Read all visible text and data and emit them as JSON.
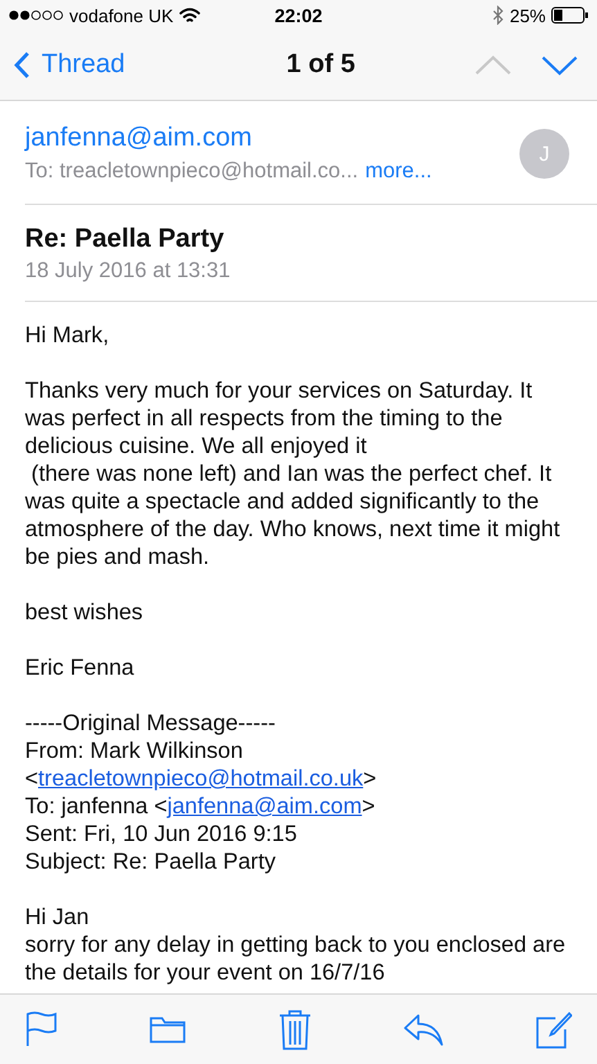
{
  "status_bar": {
    "carrier": "vodafone UK",
    "time": "22:02",
    "battery": "25%"
  },
  "nav": {
    "back": "Thread",
    "position": "1 of 5",
    "arrows": [
      {
        "kind": "up",
        "disabled": true
      },
      {
        "kind": "down",
        "disabled": false
      }
    ]
  },
  "header": {
    "from": "janfenna@aim.com",
    "to": "To: treacletownpieco@hotmail.co...",
    "more": "more...",
    "avatar": "J"
  },
  "subject": {
    "title": "Re: Paella Party",
    "date": "18 July 2016 at 13:31"
  },
  "body": [
    [
      "Hi Mark,"
    ],
    [
      "Thanks very much for your services on Saturday. It",
      "was perfect in all respects from the timing to the",
      "delicious cuisine. We all enjoyed it",
      " (there was none left) and Ian was the perfect chef. It",
      "was quite a spectacle and added significantly to the",
      "atmosphere of the day. Who knows, next time it might",
      "be pies and mash."
    ],
    [
      "best wishes"
    ],
    [
      "Eric Fenna"
    ],
    [
      "-----Original Message-----",
      "From: Mark Wilkinson",
      [
        {
          "text": "<"
        },
        {
          "text": "treacletownpieco@hotmail.co.uk",
          "link": true
        },
        {
          "text": ">"
        }
      ],
      [
        {
          "text": "To: janfenna <"
        },
        {
          "text": "janfenna@aim.com",
          "link": true
        },
        {
          "text": ">"
        }
      ],
      "Sent: Fri, 10 Jun 2016 9:15",
      "Subject: Re: Paella Party"
    ],
    [
      "Hi Jan",
      "sorry for any delay in getting back to you enclosed are",
      "the details for your event on 16/7/16"
    ]
  ],
  "toolbar": [
    {
      "kind": "flag"
    },
    {
      "kind": "folder"
    },
    {
      "kind": "trash"
    },
    {
      "kind": "reply"
    },
    {
      "kind": "compose"
    }
  ]
}
